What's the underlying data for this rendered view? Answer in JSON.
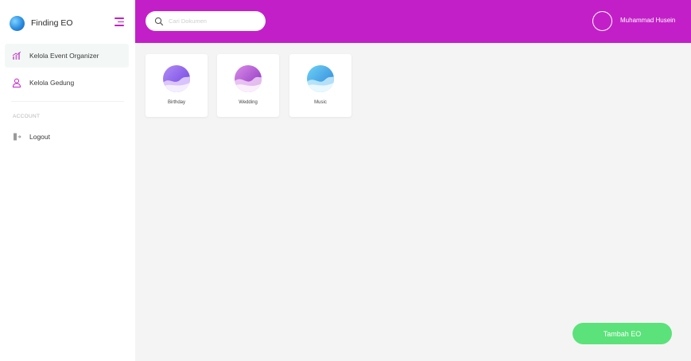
{
  "sidebar": {
    "brand": {
      "name": "Finding EO",
      "logo_icon": "globe-logo-icon"
    },
    "menu_toggle_icon": "menu-toggle-icon",
    "items": [
      {
        "label": "Kelola Event Organizer",
        "icon": "chart-icon",
        "active": true
      },
      {
        "label": "Kelola Gedung",
        "icon": "user-icon",
        "active": false
      }
    ],
    "account_section": {
      "title": "ACCOUNT",
      "items": [
        {
          "label": "Logout",
          "icon": "logout-icon"
        }
      ]
    }
  },
  "header": {
    "search": {
      "placeholder": "Cari Dokumen",
      "value": "",
      "icon": "search-icon"
    },
    "user": {
      "name": "Muhammad Husein",
      "avatar_icon": "avatar-icon"
    }
  },
  "categories": [
    {
      "label": "Birthday",
      "icon": "birthday-image-icon"
    },
    {
      "label": "Wedding",
      "icon": "wedding-image-icon"
    },
    {
      "label": "Music",
      "icon": "music-image-icon"
    }
  ],
  "actions": {
    "add_label": "Tambah EO"
  },
  "colors": {
    "brand": "#c31fc8",
    "accent_green": "#5be27a",
    "background": "#f4f4f4",
    "sidebar_active": "#f3f8f7"
  }
}
